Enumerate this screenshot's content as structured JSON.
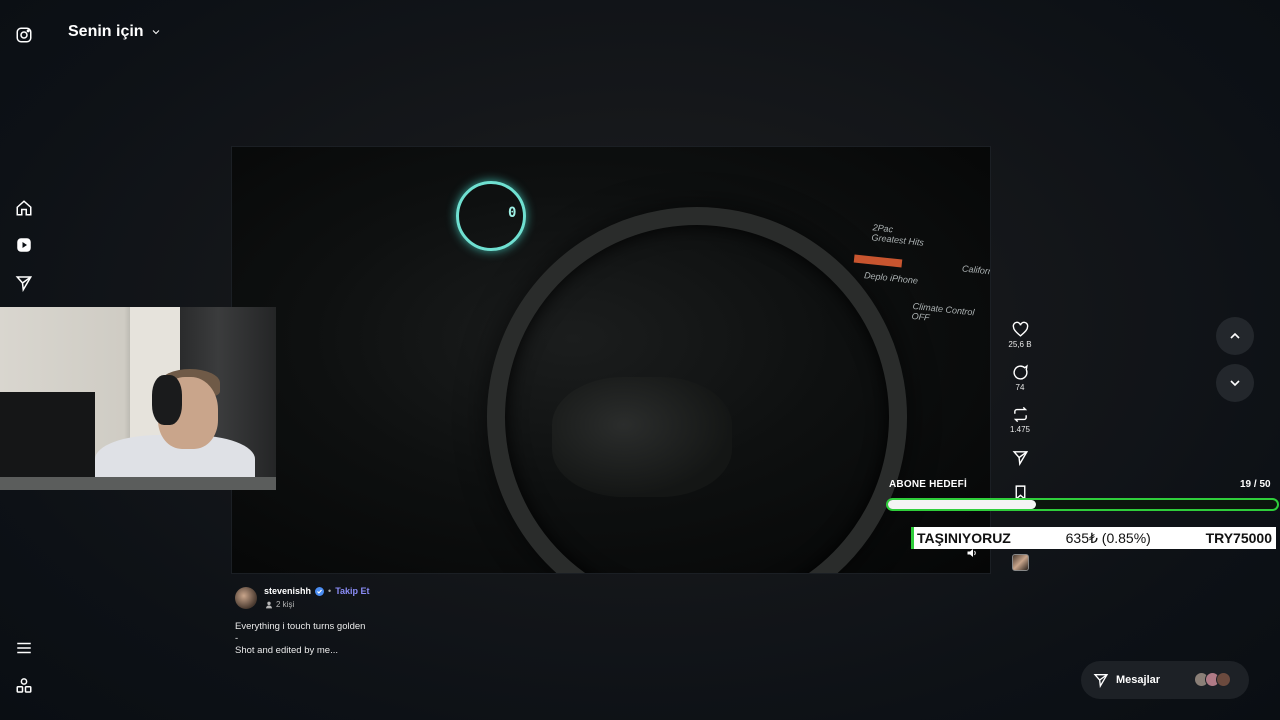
{
  "header": {
    "feed_title": "Senin için"
  },
  "post": {
    "author": "stevenishh",
    "follow_label": "Takip Et",
    "viewers": "2 kişi",
    "caption_lines": [
      "Everything i touch turns golden",
      "-",
      "Shot and edited by me..."
    ],
    "video_screen_text": {
      "speed": "0",
      "track": "2Pac\nGreatest Hits",
      "device": "Deplo iPhone",
      "right": "Californ",
      "climate": "Climate Control OFF"
    }
  },
  "actions": {
    "likes": "25,6 B",
    "comments": "74",
    "reposts": "1.475"
  },
  "goal": {
    "title": "ABONE HEDEFİ",
    "count": "19 / 50",
    "progress_fraction": 0.38,
    "accent_color": "#2fce3b"
  },
  "ticker": {
    "left": "TAŞINIYORUZ",
    "middle": "635₺ (0.85%)",
    "right": "TRY75000"
  },
  "messages": {
    "label": "Mesajlar"
  },
  "icons": {
    "instagram": "instagram-logo-icon",
    "home": "home-icon",
    "reels": "reels-icon",
    "send": "send-icon",
    "menu": "menu-icon",
    "apps": "apps-icon"
  }
}
